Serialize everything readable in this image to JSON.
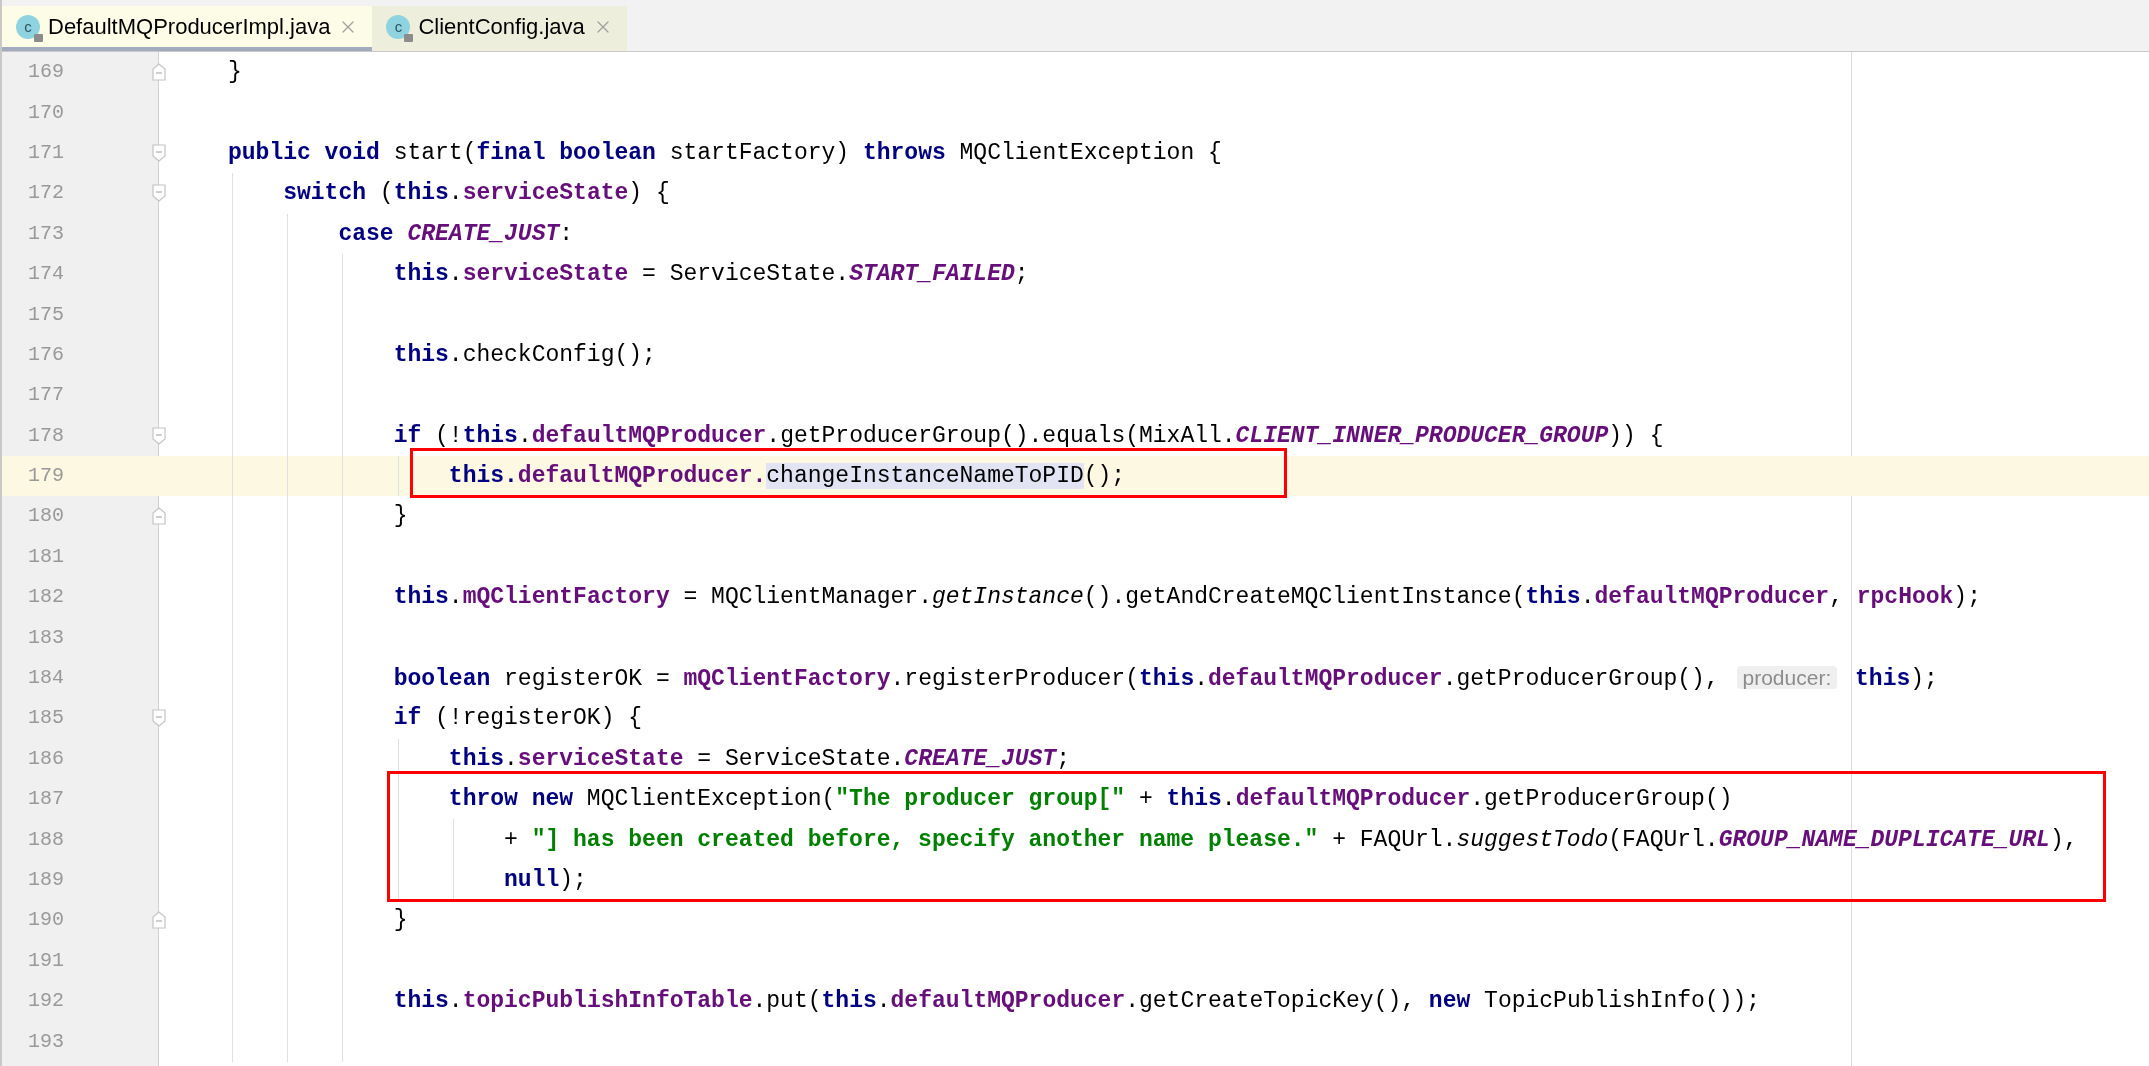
{
  "tabs": [
    {
      "icon_letter": "c",
      "label": "DefaultMQProducerImpl.java",
      "selected": true
    },
    {
      "icon_letter": "c",
      "label": "ClientConfig.java",
      "selected": false
    }
  ],
  "lines": [
    {
      "number": "169",
      "fold_start": false,
      "fold_end": true,
      "tokens": [
        {
          "kind": "plain",
          "text": "}"
        }
      ]
    },
    {
      "number": "170",
      "fold_start": false,
      "fold_end": false
    },
    {
      "number": "171",
      "fold_start": true,
      "fold_end": false,
      "tokens": [
        {
          "kind": "kw",
          "text": "public void"
        },
        {
          "kind": "plain",
          "text": " start("
        },
        {
          "kind": "kw",
          "text": "final boolean"
        },
        {
          "kind": "plain",
          "text": " startFactory) "
        },
        {
          "kind": "kw",
          "text": "throws"
        },
        {
          "kind": "plain",
          "text": " MQClientException {"
        }
      ]
    },
    {
      "number": "172",
      "fold_start": true,
      "fold_end": false,
      "tokens": [
        {
          "kind": "kw",
          "text": "    switch"
        },
        {
          "kind": "plain",
          "text": " ("
        },
        {
          "kind": "kw",
          "text": "this"
        },
        {
          "kind": "plain",
          "text": "."
        },
        {
          "kind": "field",
          "text": "serviceState"
        },
        {
          "kind": "plain",
          "text": ") {"
        }
      ]
    },
    {
      "number": "173",
      "fold_start": false,
      "fold_end": false,
      "tokens": [
        {
          "kind": "kw",
          "text": "        case "
        },
        {
          "kind": "const",
          "text": "CREATE_JUST"
        },
        {
          "kind": "plain",
          "text": ":"
        }
      ]
    },
    {
      "number": "174",
      "fold_start": false,
      "fold_end": false,
      "tokens": [
        {
          "kind": "kw",
          "text": "            this"
        },
        {
          "kind": "plain",
          "text": "."
        },
        {
          "kind": "field",
          "text": "serviceState"
        },
        {
          "kind": "plain",
          "text": " = ServiceState."
        },
        {
          "kind": "const",
          "text": "START_FAILED"
        },
        {
          "kind": "plain",
          "text": ";"
        }
      ]
    },
    {
      "number": "175",
      "fold_start": false,
      "fold_end": false
    },
    {
      "number": "176",
      "fold_start": false,
      "fold_end": false,
      "tokens": [
        {
          "kind": "kw",
          "text": "            this"
        },
        {
          "kind": "plain",
          "text": ".checkConfig();"
        }
      ]
    },
    {
      "number": "177",
      "fold_start": false,
      "fold_end": false
    },
    {
      "number": "178",
      "fold_start": true,
      "fold_end": false,
      "tokens": [
        {
          "kind": "kw",
          "text": "            if"
        },
        {
          "kind": "plain",
          "text": " (!"
        },
        {
          "kind": "kw",
          "text": "this"
        },
        {
          "kind": "plain",
          "text": "."
        },
        {
          "kind": "field",
          "text": "defaultMQProducer"
        },
        {
          "kind": "plain",
          "text": ".getProducerGroup().equals(MixAll."
        },
        {
          "kind": "const",
          "text": "CLIENT_INNER_PRODUCER_GROUP"
        },
        {
          "kind": "plain",
          "text": ")) {"
        }
      ]
    },
    {
      "number": "179",
      "fold_start": false,
      "fold_end": false,
      "current": true,
      "boxed": true,
      "tokens": [
        {
          "kind": "kw",
          "text": "                this."
        },
        {
          "kind": "field",
          "text": "defaultMQProducer."
        },
        {
          "kind": "usage",
          "text": "changeInstanceNameToPID"
        },
        {
          "kind": "plain",
          "text": "();"
        }
      ]
    },
    {
      "number": "180",
      "fold_start": false,
      "fold_end": true,
      "tokens": [
        {
          "kind": "plain",
          "text": "            }"
        }
      ]
    },
    {
      "number": "181",
      "fold_start": false,
      "fold_end": false
    },
    {
      "number": "182",
      "fold_start": false,
      "fold_end": false,
      "tokens": [
        {
          "kind": "kw",
          "text": "            this"
        },
        {
          "kind": "plain",
          "text": "."
        },
        {
          "kind": "field",
          "text": "mQClientFactory"
        },
        {
          "kind": "plain",
          "text": " = MQClientManager."
        },
        {
          "kind": "scall",
          "text": "getInstance"
        },
        {
          "kind": "plain",
          "text": "().getAndCreateMQClientInstance("
        },
        {
          "kind": "kw",
          "text": "this"
        },
        {
          "kind": "plain",
          "text": "."
        },
        {
          "kind": "field",
          "text": "defaultMQProducer"
        },
        {
          "kind": "plain",
          "text": ", "
        },
        {
          "kind": "field",
          "text": "rpcHook"
        },
        {
          "kind": "plain",
          "text": ");"
        }
      ]
    },
    {
      "number": "183",
      "fold_start": false,
      "fold_end": false
    },
    {
      "number": "184",
      "fold_start": false,
      "fold_end": false,
      "tokens": [
        {
          "kind": "kw",
          "text": "            boolean"
        },
        {
          "kind": "plain",
          "text": " registerOK = "
        },
        {
          "kind": "field",
          "text": "mQClientFactory"
        },
        {
          "kind": "plain",
          "text": ".registerProducer("
        },
        {
          "kind": "kw",
          "text": "this"
        },
        {
          "kind": "plain",
          "text": "."
        },
        {
          "kind": "field",
          "text": "defaultMQProducer"
        },
        {
          "kind": "plain",
          "text": ".getProducerGroup(), "
        },
        {
          "kind": "hint",
          "text": "producer:"
        },
        {
          "kind": "kw",
          "text": " this"
        },
        {
          "kind": "plain",
          "text": ");"
        }
      ]
    },
    {
      "number": "185",
      "fold_start": true,
      "fold_end": false,
      "tokens": [
        {
          "kind": "kw",
          "text": "            if"
        },
        {
          "kind": "plain",
          "text": " (!registerOK) {"
        }
      ]
    },
    {
      "number": "186",
      "fold_start": false,
      "fold_end": false,
      "tokens": [
        {
          "kind": "kw",
          "text": "                this"
        },
        {
          "kind": "plain",
          "text": "."
        },
        {
          "kind": "field",
          "text": "serviceState"
        },
        {
          "kind": "plain",
          "text": " = ServiceState."
        },
        {
          "kind": "const",
          "text": "CREATE_JUST"
        },
        {
          "kind": "plain",
          "text": ";"
        }
      ]
    },
    {
      "number": "187",
      "fold_start": false,
      "fold_end": false,
      "boxed": true,
      "tokens": [
        {
          "kind": "kw",
          "text": "                throw new"
        },
        {
          "kind": "plain",
          "text": " MQClientException("
        },
        {
          "kind": "str",
          "text": "\"The producer group[\""
        },
        {
          "kind": "plain",
          "text": " + "
        },
        {
          "kind": "kw",
          "text": "this"
        },
        {
          "kind": "plain",
          "text": "."
        },
        {
          "kind": "field",
          "text": "defaultMQProducer"
        },
        {
          "kind": "plain",
          "text": ".getProducerGroup()"
        }
      ]
    },
    {
      "number": "188",
      "fold_start": false,
      "fold_end": false,
      "boxed": true,
      "tokens": [
        {
          "kind": "plain",
          "text": "                    + "
        },
        {
          "kind": "str",
          "text": "\"] has been created before, specify another name please.\""
        },
        {
          "kind": "plain",
          "text": " + FAQUrl."
        },
        {
          "kind": "scall",
          "text": "suggestTodo"
        },
        {
          "kind": "plain",
          "text": "(FAQUrl."
        },
        {
          "kind": "const",
          "text": "GROUP_NAME_DUPLICATE_URL"
        },
        {
          "kind": "plain",
          "text": "),"
        }
      ]
    },
    {
      "number": "189",
      "fold_start": false,
      "fold_end": false,
      "boxed": true,
      "tokens": [
        {
          "kind": "kw",
          "text": "                    null"
        },
        {
          "kind": "plain",
          "text": ");"
        }
      ]
    },
    {
      "number": "190",
      "fold_start": false,
      "fold_end": true,
      "tokens": [
        {
          "kind": "plain",
          "text": "            }"
        }
      ]
    },
    {
      "number": "191",
      "fold_start": false,
      "fold_end": false
    },
    {
      "number": "192",
      "fold_start": false,
      "fold_end": false,
      "tokens": [
        {
          "kind": "kw",
          "text": "            this"
        },
        {
          "kind": "plain",
          "text": "."
        },
        {
          "kind": "field",
          "text": "topicPublishInfoTable"
        },
        {
          "kind": "plain",
          "text": ".put("
        },
        {
          "kind": "kw",
          "text": "this"
        },
        {
          "kind": "plain",
          "text": "."
        },
        {
          "kind": "field",
          "text": "defaultMQProducer"
        },
        {
          "kind": "plain",
          "text": ".getCreateTopicKey(), "
        },
        {
          "kind": "kw",
          "text": "new"
        },
        {
          "kind": "plain",
          "text": " TopicPublishInfo());"
        }
      ]
    },
    {
      "number": "193",
      "fold_start": false,
      "fold_end": false
    }
  ]
}
